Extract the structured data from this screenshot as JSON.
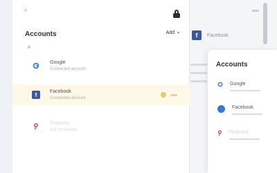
{
  "main": {
    "close_icon": "×",
    "title": "Accounts",
    "dropdown_label": "Add",
    "dropdown_chevron": "▾",
    "accounts": [
      {
        "name": "Google",
        "sub": "Connected account",
        "icon": "google-icon",
        "state": "normal"
      },
      {
        "name": "Facebook",
        "sub": "Connected account",
        "icon": "facebook-icon",
        "state": "active"
      },
      {
        "name": "Pinterest",
        "sub": "Not connected",
        "icon": "pinterest-icon",
        "state": "disabled"
      }
    ]
  },
  "back_panel": {
    "account_label": "Facebook",
    "fb_glyph": "f"
  },
  "front_card": {
    "title": "Accounts",
    "items": [
      {
        "name": "Google",
        "icon": "google-icon"
      },
      {
        "name": "Facebook",
        "icon": "facebook-icon"
      },
      {
        "name": "Pinterest",
        "icon": "pinterest-icon"
      }
    ]
  },
  "colors": {
    "facebook": "#3b5998",
    "pinterest": "#e0434e",
    "highlight": "#fdf8e8",
    "accent_dot": "#e8c96a"
  }
}
